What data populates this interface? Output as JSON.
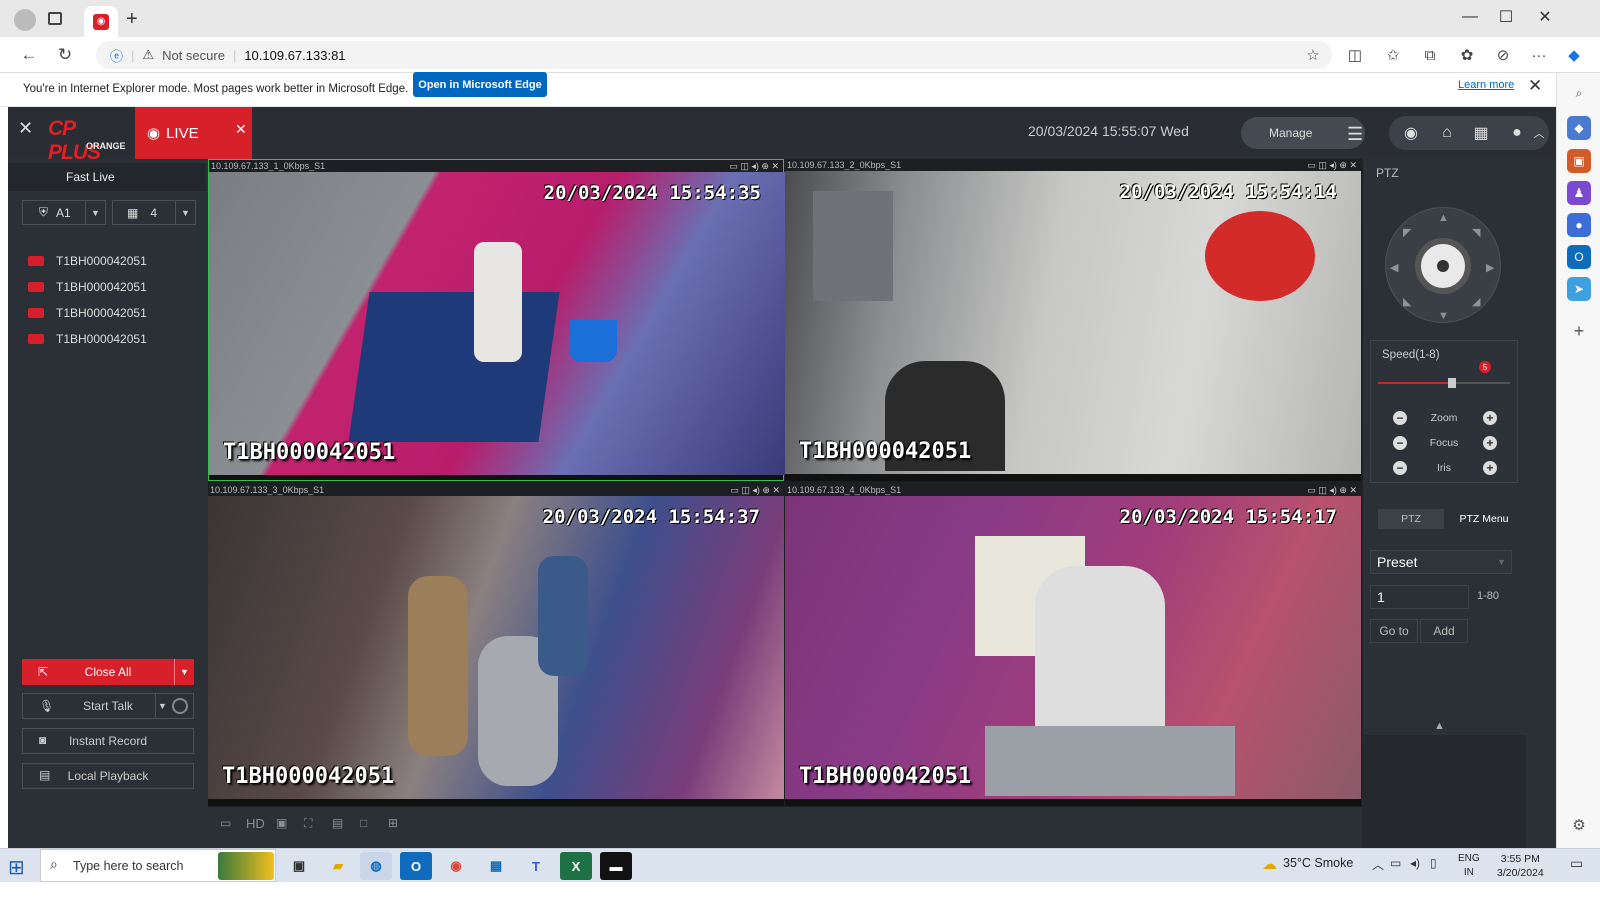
{
  "browser": {
    "not_secure": "Not secure",
    "url": "10.109.67.133:81",
    "ie_message": "You're in Internet Explorer mode. Most pages work better in Microsoft Edge.",
    "open_edge_label": "Open in Microsoft Edge",
    "learn_more": "Learn more"
  },
  "app": {
    "logo_text": "CP PLUS",
    "logo_sub": "ORANGE",
    "live_tab": "LIVE",
    "datetime": "20/03/2024 15:55:07 Wed",
    "manage_label": "Manage"
  },
  "sidebar": {
    "fast_live": "Fast Live",
    "select_a": "A1",
    "select_split": "4",
    "cameras": [
      "T1BH000042051",
      "T1BH000042051",
      "T1BH000042051",
      "T1BH000042051"
    ],
    "close_all": "Close All",
    "start_talk": "Start Talk",
    "instant_record": "Instant Record",
    "local_playback": "Local Playback"
  },
  "feeds": [
    {
      "title": "10.109.67.133_1_0Kbps_S1",
      "timestamp": "20/03/2024 15:54:35",
      "camera": "T1BH000042051"
    },
    {
      "title": "10.109.67.133_2_0Kbps_S1",
      "timestamp": "20/03/2024 15:54:14",
      "camera": "T1BH000042051"
    },
    {
      "title": "10.109.67.133_3_0Kbps_S1",
      "timestamp": "20/03/2024 15:54:37",
      "camera": "T1BH000042051"
    },
    {
      "title": "10.109.67.133_4_0Kbps_S1",
      "timestamp": "20/03/2024 15:54:17",
      "camera": "T1BH000042051"
    }
  ],
  "bottom_toolbar": {
    "hd_label": "HD"
  },
  "ptz": {
    "title": "PTZ",
    "speed_label": "Speed(1-8)",
    "speed_value": "5",
    "speed_fraction": 0.56,
    "zoom": "Zoom",
    "focus": "Focus",
    "iris": "Iris",
    "tab_ptz": "PTZ",
    "tab_menu": "PTZ Menu",
    "preset_label": "Preset",
    "preset_value": "1",
    "preset_range": "1-80",
    "goto": "Go to",
    "add": "Add"
  },
  "taskbar": {
    "search_placeholder": "Type here to search",
    "weather": "35°C  Smoke",
    "lang1": "ENG",
    "lang2": "IN",
    "time": "3:55 PM",
    "date": "3/20/2024"
  },
  "colors": {
    "accent": "#d7202a",
    "panel": "#2b2f36",
    "edge_blue": "#0067c0"
  }
}
